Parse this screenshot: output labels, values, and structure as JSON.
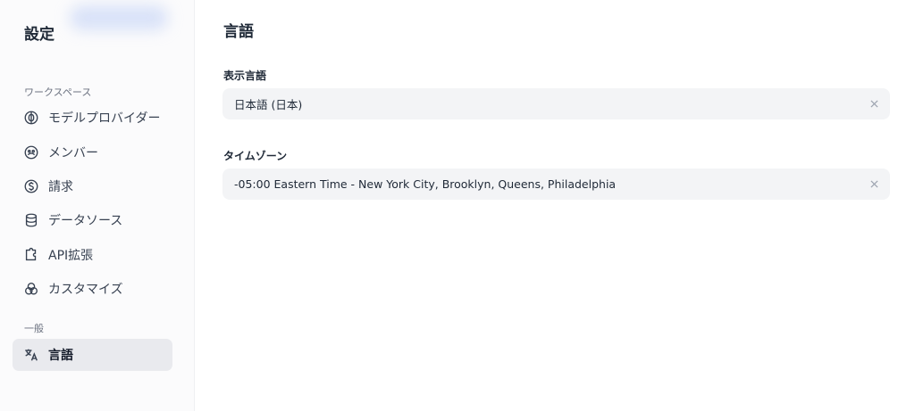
{
  "sidebar": {
    "title": "設定",
    "workspace_section": "ワークスペース",
    "general_section": "一般",
    "items": [
      {
        "label": "モデルプロバイダー",
        "icon": "brain-icon"
      },
      {
        "label": "メンバー",
        "icon": "members-icon"
      },
      {
        "label": "請求",
        "icon": "dollar-icon"
      },
      {
        "label": "データソース",
        "icon": "database-icon"
      },
      {
        "label": "API拡張",
        "icon": "puzzle-icon"
      },
      {
        "label": "カスタマイズ",
        "icon": "circles-icon"
      }
    ],
    "general_items": [
      {
        "label": "言語",
        "icon": "translate-icon",
        "active": true
      }
    ]
  },
  "main": {
    "title": "言語",
    "display_language": {
      "label": "表示言語",
      "value": "日本語 (日本)"
    },
    "timezone": {
      "label": "タイムゾーン",
      "value": "-05:00 Eastern Time - New York City, Brooklyn, Queens, Philadelphia"
    }
  },
  "colors": {
    "sidebar_bg": "#fbfbfc",
    "active_bg": "#e9eaee",
    "field_bg": "#f3f4f6",
    "text": "#1f2937"
  }
}
